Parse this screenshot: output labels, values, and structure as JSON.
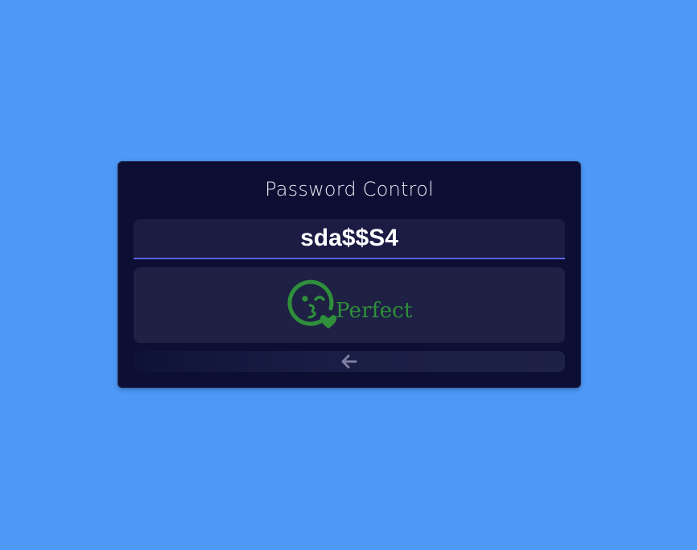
{
  "card": {
    "title": "Password Control"
  },
  "password": {
    "value": "sda$$S4"
  },
  "strength": {
    "label": "Perfect",
    "icon": "kissing-heart-emoji-icon",
    "color": "#2f8f3b"
  },
  "back_button": {
    "icon": "arrow-left-icon"
  },
  "colors": {
    "background": "#4d99f8",
    "card": "#0c0f33",
    "input_underline": "#5a63e8",
    "result_text": "#2f8f3b"
  }
}
